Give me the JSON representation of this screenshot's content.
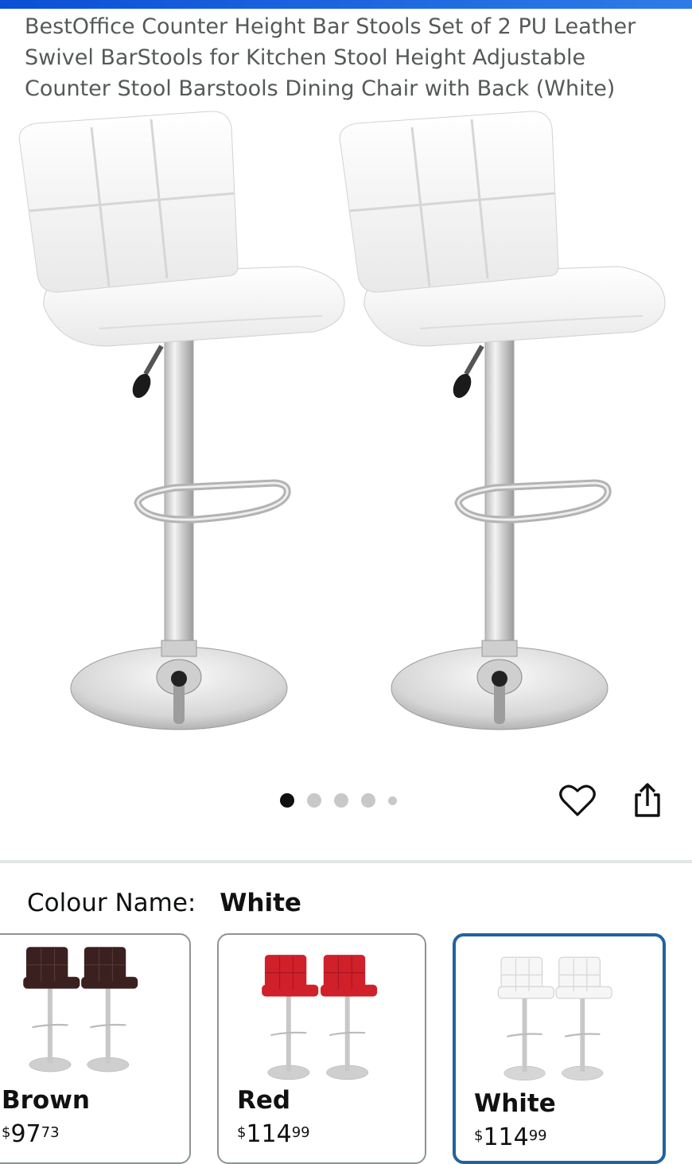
{
  "product": {
    "title": "BestOffice Counter Height Bar Stools Set of 2 PU Leather Swivel BarStools for Kitchen Stool Height Adjustable Counter Stool Barstools Dining Chair with Back (White)"
  },
  "gallery": {
    "image_count": 5,
    "active_index": 0
  },
  "actions": {
    "wishlist_icon": "heart-icon",
    "share_icon": "share-icon"
  },
  "variation": {
    "label": "Colour Name:",
    "selected": "White",
    "options": [
      {
        "name": "Brown",
        "currency": "$",
        "whole": "97",
        "cents": "73",
        "seat_color": "#3b2020"
      },
      {
        "name": "Red",
        "currency": "$",
        "whole": "114",
        "cents": "99",
        "seat_color": "#d0202a"
      },
      {
        "name": "White",
        "currency": "$",
        "whole": "114",
        "cents": "99",
        "seat_color": "#f6f6f6"
      }
    ]
  },
  "colors": {
    "top_bar": "#0b4fd6",
    "selected_border": "#2162a1",
    "title_text": "#565959"
  }
}
